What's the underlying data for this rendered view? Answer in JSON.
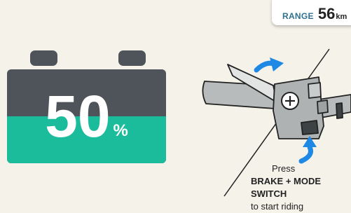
{
  "range": {
    "label": "RANGE",
    "value": "56",
    "unit": "km"
  },
  "battery": {
    "percent": "50",
    "percent_symbol": "%",
    "level": 0.5
  },
  "instructions": {
    "line1": "Press",
    "line2": "BRAKE + MODE SWITCH",
    "line3": "to start riding"
  },
  "colors": {
    "background": "#f4f2e9",
    "battery_empty": "#4e5459",
    "battery_fill": "#1abc9c",
    "arrow": "#1e88e5",
    "range_label": "#2f6f8f"
  },
  "icons": [
    "brake-arrow-icon",
    "mode-switch-arrow-icon",
    "plus-icon"
  ]
}
